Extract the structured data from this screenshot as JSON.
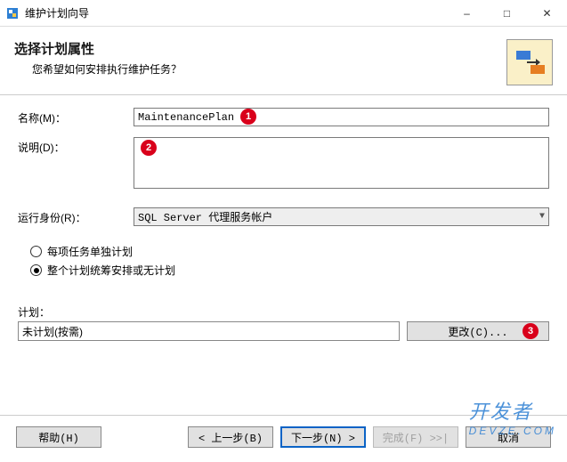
{
  "titlebar": {
    "title": "维护计划向导"
  },
  "header": {
    "title": "选择计划属性",
    "subtitle": "您希望如何安排执行维护任务？"
  },
  "labels": {
    "name": "名称(M)：",
    "desc": "说明(D)：",
    "runas": "运行身份(R)：",
    "schedule": "计划："
  },
  "fields": {
    "name_value": "MaintenancePlan",
    "desc_value": "",
    "runas_value": "SQL Server 代理服务帐户",
    "schedule_value": "未计划(按需)"
  },
  "radios": {
    "option1": "每项任务单独计划",
    "option2": "整个计划统筹安排或无计划"
  },
  "buttons": {
    "change": "更改(C)...",
    "help": "帮助(H)",
    "back": "< 上一步(B)",
    "next": "下一步(N) >",
    "finish": "完成(F) >>|",
    "cancel": "取消"
  },
  "callouts": {
    "c1": "1",
    "c2": "2",
    "c3": "3"
  },
  "watermark": {
    "line1": "开发者",
    "line2": "DEVZE.COM"
  }
}
